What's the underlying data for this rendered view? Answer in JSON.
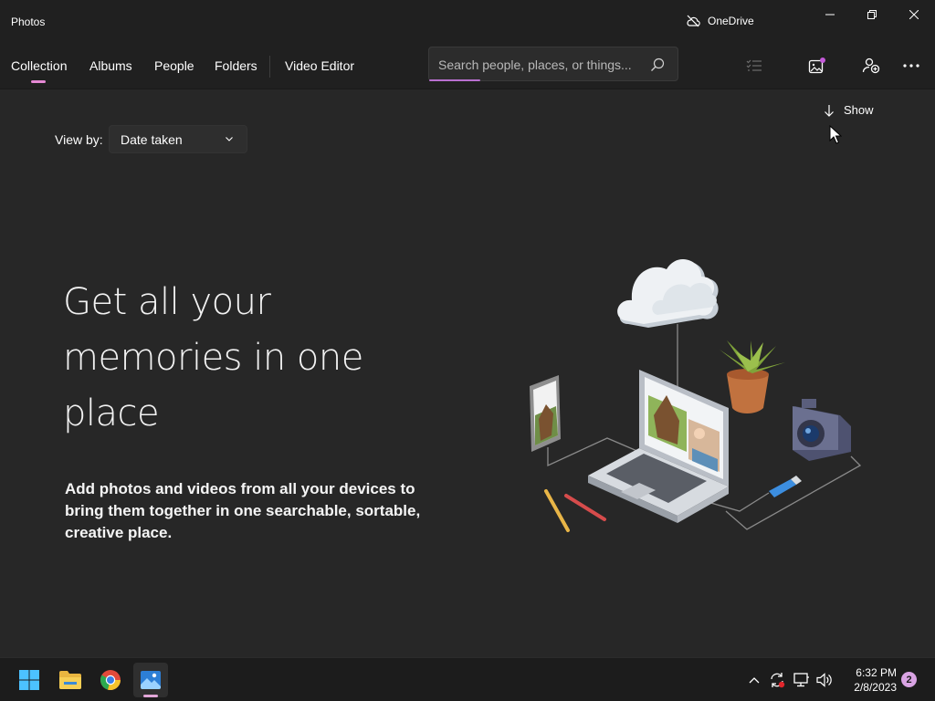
{
  "window": {
    "title": "Photos",
    "onedrive_label": "OneDrive",
    "icons": [
      "cloud-off-icon",
      "minimize-icon",
      "restore-icon",
      "close-icon"
    ]
  },
  "nav": {
    "tabs": [
      {
        "label": "Collection",
        "active": true
      },
      {
        "label": "Albums"
      },
      {
        "label": "People"
      },
      {
        "label": "Folders"
      },
      {
        "label": "Video Editor"
      }
    ],
    "search_placeholder": "Search people, places, or things...",
    "toolbar_icons": [
      "select-list-icon",
      "photo-notification-icon",
      "add-people-icon",
      "more-options-icon"
    ]
  },
  "content": {
    "show_label": "Show",
    "view_by_label": "View by:",
    "view_by_value": "Date taken",
    "headline_lines": [
      "Get all your",
      "memories in one",
      "place"
    ],
    "subtext": "Add photos and videos from all your devices to bring them together in one searchable, sortable, creative place."
  },
  "taskbar": {
    "apps": [
      "start-icon",
      "file-explorer-icon",
      "chrome-icon",
      "photos-icon"
    ],
    "tray_icons": [
      "chevron-up-icon",
      "sync-icon",
      "network-icon",
      "volume-icon"
    ],
    "time": "6:32 PM",
    "date": "2/8/2023",
    "notification_count": "2"
  },
  "colors": {
    "accent": "#b86fd0",
    "tab_indicator": "#e589d4",
    "background": "#272727",
    "chrome": "#202020"
  }
}
